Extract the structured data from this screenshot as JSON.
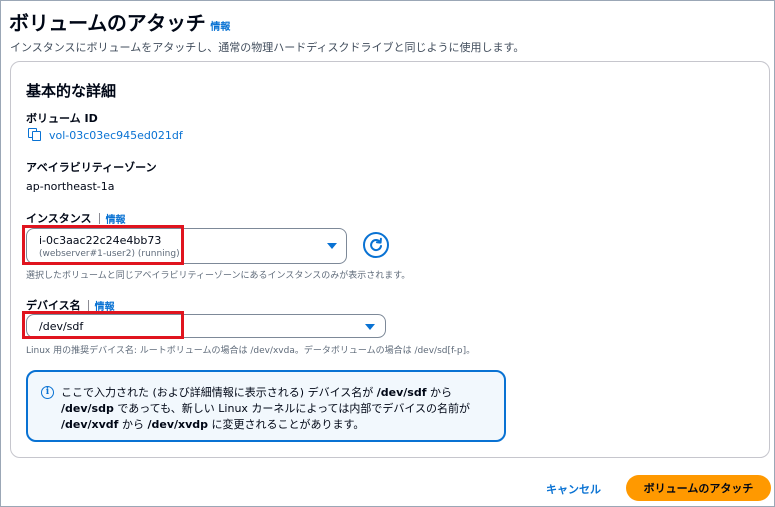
{
  "page": {
    "title": "ボリュームのアタッチ",
    "info_label": "情報",
    "description": "インスタンスにボリュームをアタッチし、通常の物理ハードディスクドライブと同じように使用します。"
  },
  "details": {
    "header": "基本的な詳細",
    "volume_id_label": "ボリューム ID",
    "volume_id_value": "vol-03c03ec945ed021df",
    "az_label": "アベイラビリティーゾーン",
    "az_value": "ap-northeast-1a",
    "instance_label": "インスタンス",
    "instance_info": "情報",
    "instance_value": "i-0c3aac22c24e4bb73",
    "instance_sub": "(webserver#1-user2) (running)",
    "instance_hint": "選択したボリュームと同じアベイラビリティーゾーンにあるインスタンスのみが表示されます。",
    "device_label": "デバイス名",
    "device_info": "情報",
    "device_value": "/dev/sdf",
    "device_hint": "Linux 用の推奨デバイス名: ルートボリュームの場合は /dev/xvda。データボリュームの場合は /dev/sd[f-p]。"
  },
  "alert": {
    "line1_pre": "ここで入力された (および詳細情報に表示される) デバイス名が ",
    "line1_bold": "/dev/sdf",
    "line1_post": " から",
    "line2_bold": "/dev/sdp",
    "line2_post": " であっても、新しい Linux カーネルによっては内部でデバイスの名前が",
    "line3_bold1": "/dev/xvdf",
    "line3_mid": " から ",
    "line3_bold2": "/dev/xvdp",
    "line3_post": " に変更されることがあります。"
  },
  "actions": {
    "cancel": "キャンセル",
    "attach": "ボリュームのアタッチ"
  },
  "colors": {
    "link_blue": "#0972d3",
    "primary_orange": "#ff9900",
    "highlight_red": "#e0141e"
  },
  "icons": [
    "copy-icon",
    "refresh-icon",
    "info-circle-icon",
    "caret-down-icon"
  ]
}
